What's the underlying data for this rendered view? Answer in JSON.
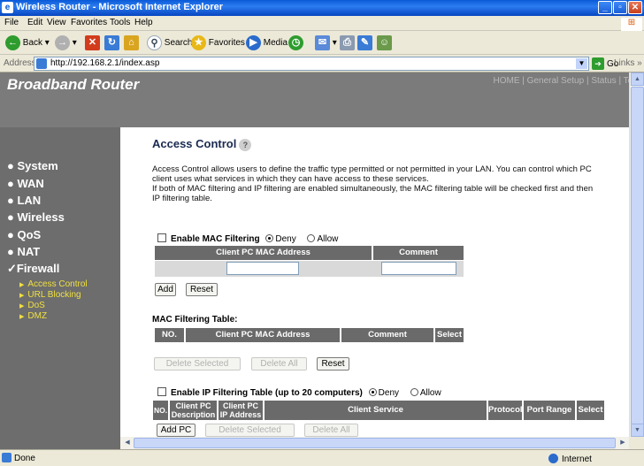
{
  "window": {
    "title": "Wireless Router - Microsoft Internet Explorer"
  },
  "menu": [
    "File",
    "Edit",
    "View",
    "Favorites",
    "Tools",
    "Help"
  ],
  "toolbar": {
    "back": "Back",
    "search": "Search",
    "favorites": "Favorites",
    "media": "Media"
  },
  "address": {
    "label": "Address",
    "url": "http://192.168.2.1/index.asp",
    "go": "Go",
    "links": "Links"
  },
  "banner": {
    "brand": "Broadband Router",
    "topnav": "HOME | General Setup | Status | Tools"
  },
  "sidebar": {
    "items": [
      "System",
      "WAN",
      "LAN",
      "Wireless",
      "QoS",
      "NAT",
      "Firewall"
    ],
    "subitems": [
      "Access Control",
      "URL Blocking",
      "DoS",
      "DMZ"
    ]
  },
  "page": {
    "title": "Access Control",
    "desc": "Access Control allows users to define the traffic type permitted or not permitted in your LAN. You can control which PC client uses what services in which they can have access to these services.",
    "desc2": "If both of MAC filtering and IP filtering are enabled simultaneously, the MAC filtering table will be checked first and then IP filtering table."
  },
  "mac_filter": {
    "enable_label": "Enable MAC Filtering",
    "deny": "Deny",
    "allow": "Allow",
    "col_mac": "Client PC MAC Address",
    "col_comment": "Comment",
    "add": "Add",
    "reset": "Reset",
    "table_title": "MAC Filtering Table:",
    "table_cols": [
      "NO.",
      "Client PC MAC Address",
      "Comment",
      "Select"
    ],
    "delete_selected": "Delete Selected",
    "delete_all": "Delete All",
    "reset2": "Reset"
  },
  "ip_filter": {
    "enable_label": "Enable IP Filtering Table (up to 20 computers)",
    "deny": "Deny",
    "allow": "Allow",
    "cols": [
      "NO.",
      "Client PC Description",
      "Client PC IP Address",
      "Client Service",
      "Protocol",
      "Port Range",
      "Select"
    ],
    "add_pc": "Add PC",
    "delete_selected": "Delete Selected",
    "delete_all": "Delete All"
  },
  "statusbar": {
    "status": "Done",
    "zone": "Internet"
  }
}
